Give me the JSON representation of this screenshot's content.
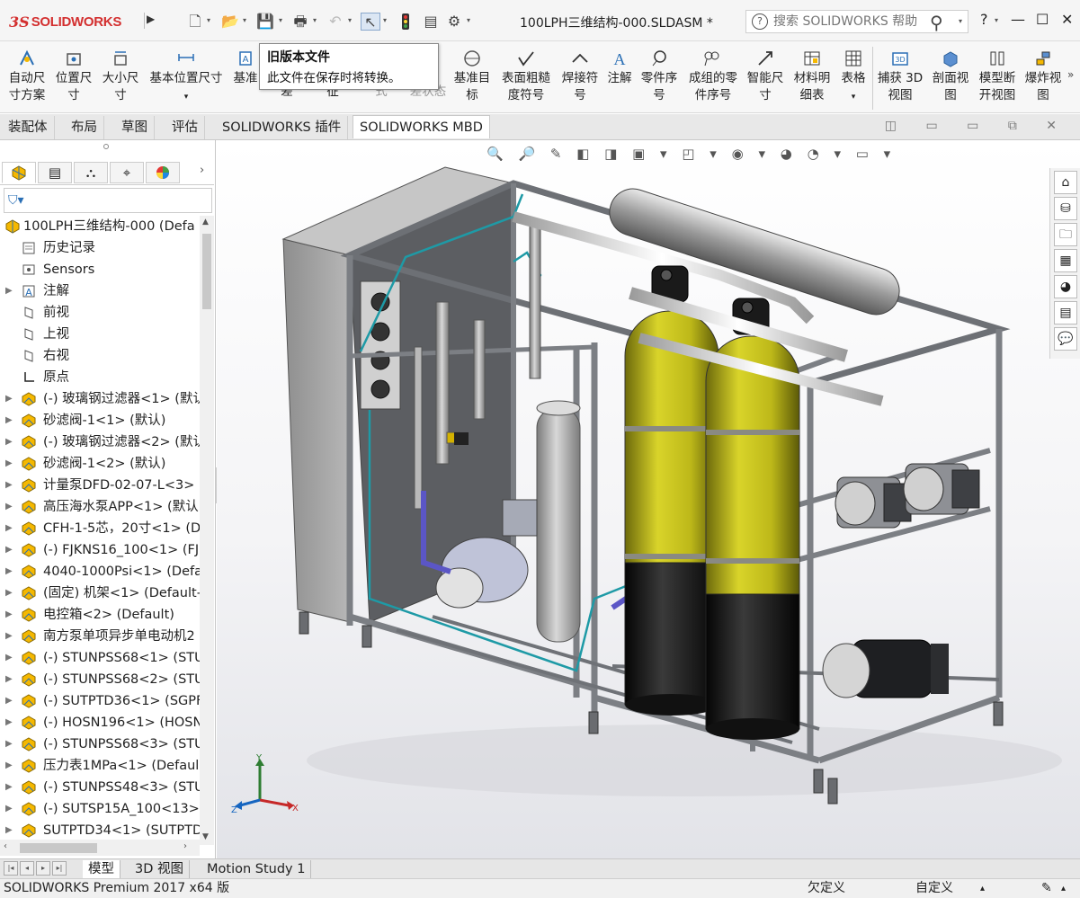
{
  "app": {
    "logo_prefix": "3S",
    "logo_text": "SOLIDWORKS",
    "doc_title": "100LPH三维结构-000.SLDASM *"
  },
  "search": {
    "placeholder": "搜索 SOLIDWORKS 帮助"
  },
  "window": {
    "help": "?",
    "minimize": "—",
    "maximize": "☐",
    "close": "✕"
  },
  "commands": [
    {
      "label1": "自动尺",
      "label2": "寸方案"
    },
    {
      "label1": "位置尺",
      "label2": "寸"
    },
    {
      "label1": "大小尺",
      "label2": "寸"
    },
    {
      "label1": "基本位置尺寸",
      "label2": ""
    },
    {
      "label1": "基准",
      "label2": ""
    },
    {
      "label1": "",
      "label2": "差"
    },
    {
      "label1": "",
      "label2": "征"
    },
    {
      "label1": "",
      "label2": "式"
    },
    {
      "label1": "",
      "label2": "差状态"
    },
    {
      "label1": "基准目",
      "label2": "标"
    },
    {
      "label1": "表面粗糙",
      "label2": "度符号"
    },
    {
      "label1": "焊接符",
      "label2": "号"
    },
    {
      "label1": "注解",
      "label2": ""
    },
    {
      "label1": "零件序",
      "label2": "号"
    },
    {
      "label1": "成组的零",
      "label2": "件序号"
    },
    {
      "label1": "智能尺",
      "label2": "寸"
    },
    {
      "label1": "材料明",
      "label2": "细表"
    },
    {
      "label1": "表格",
      "label2": ""
    },
    {
      "label1": "捕获 3D",
      "label2": "视图"
    },
    {
      "label1": "剖面视",
      "label2": "图"
    },
    {
      "label1": "模型断",
      "label2": "开视图"
    },
    {
      "label1": "爆炸视",
      "label2": "图"
    }
  ],
  "tooltip": {
    "title": "旧版本文件",
    "body": "此文件在保存时将转换。"
  },
  "tabs": [
    "装配体",
    "布局",
    "草图",
    "评估",
    "SOLIDWORKS 插件",
    "SOLIDWORKS MBD"
  ],
  "tree": {
    "filter_icon": "filter-icon",
    "root": "100LPH三维结构-000  (Defa",
    "items": [
      {
        "label": "历史记录",
        "icon": "history-icon",
        "expand": false
      },
      {
        "label": "Sensors",
        "icon": "sensors-icon",
        "expand": false
      },
      {
        "label": "注解",
        "icon": "annotations-icon",
        "expand": true
      },
      {
        "label": "前视",
        "icon": "plane-icon",
        "expand": false
      },
      {
        "label": "上视",
        "icon": "plane-icon",
        "expand": false
      },
      {
        "label": "右视",
        "icon": "plane-icon",
        "expand": false
      },
      {
        "label": "原点",
        "icon": "origin-icon",
        "expand": false
      },
      {
        "label": "(-) 玻璃钢过滤器<1> (默认",
        "icon": "component-icon",
        "expand": true
      },
      {
        "label": "砂滤阀-1<1> (默认)",
        "icon": "component-icon",
        "expand": true
      },
      {
        "label": "(-) 玻璃钢过滤器<2> (默认",
        "icon": "component-icon",
        "expand": true
      },
      {
        "label": "砂滤阀-1<2> (默认)",
        "icon": "component-icon",
        "expand": true
      },
      {
        "label": "计量泵DFD-02-07-L<3>",
        "icon": "component-icon",
        "expand": true
      },
      {
        "label": "高压海水泵APP<1> (默认",
        "icon": "component-icon",
        "expand": true
      },
      {
        "label": "CFH-1-5芯，20寸<1> (D",
        "icon": "component-icon",
        "expand": true
      },
      {
        "label": "(-) FJKNS16_100<1> (FJ",
        "icon": "component-icon",
        "expand": true
      },
      {
        "label": "4040-1000Psi<1> (Defa",
        "icon": "component-icon",
        "expand": true
      },
      {
        "label": "(固定) 机架<1> (Default-",
        "icon": "component-icon",
        "expand": true
      },
      {
        "label": "电控箱<2> (Default)",
        "icon": "component-icon",
        "expand": true
      },
      {
        "label": "南方泵单项异步单电动机2",
        "icon": "component-icon",
        "expand": true
      },
      {
        "label": "(-) STUNPSS68<1> (STU",
        "icon": "component-icon",
        "expand": true
      },
      {
        "label": "(-) STUNPSS68<2> (STU",
        "icon": "component-icon",
        "expand": true
      },
      {
        "label": "(-) SUTPTD36<1> (SGPF",
        "icon": "component-icon",
        "expand": true
      },
      {
        "label": "(-) HOSN196<1> (HOSN",
        "icon": "component-icon",
        "expand": true
      },
      {
        "label": "(-) STUNPSS68<3> (STU",
        "icon": "component-icon",
        "expand": true
      },
      {
        "label": "压力表1MPa<1> (Defaul",
        "icon": "component-icon",
        "expand": true
      },
      {
        "label": "(-) STUNPSS48<3> (STU",
        "icon": "component-icon",
        "expand": true
      },
      {
        "label": "(-) SUTSP15A_100<13>",
        "icon": "component-icon",
        "expand": true
      },
      {
        "label": "SUTPTD34<1> (SUTPTD",
        "icon": "component-icon",
        "expand": true
      }
    ]
  },
  "triad": {
    "x": "X",
    "y": "Y",
    "z": "Z"
  },
  "bottom_tabs": [
    "模型",
    "3D 视图",
    "Motion Study 1"
  ],
  "status": {
    "left": "SOLIDWORKS Premium 2017 x64 版",
    "state": "欠定义",
    "custom": "自定义"
  },
  "colors": {
    "accent_red": "#d32f2f",
    "tank_yellow": "#c7c21d",
    "frame_gray": "#8a8d92"
  }
}
